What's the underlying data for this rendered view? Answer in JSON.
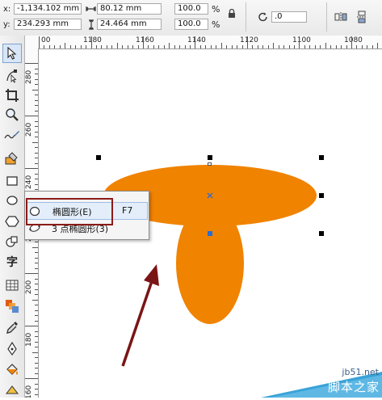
{
  "property_bar": {
    "x_label": "x:",
    "x_value": "-1,134.102 mm",
    "y_label": "y:",
    "y_value": "234.293 mm",
    "width_value": "80.12 mm",
    "height_value": "24.464 mm",
    "scale_x": "100.0",
    "scale_y": "100.0",
    "percent_1": "%",
    "percent_2": "%",
    "rotation_value": ".0"
  },
  "horizontal_ruler": {
    "labels": [
      "00",
      "1180",
      "1160",
      "1140",
      "1120",
      "1100",
      "1080"
    ]
  },
  "vertical_ruler": {
    "labels": [
      "280",
      "260",
      "240",
      "220",
      "200",
      "180",
      "160"
    ]
  },
  "toolbox": {
    "text_tool_glyph": "字"
  },
  "flyout": {
    "item1_label": "椭圆形(E)",
    "item1_shortcut": "F7",
    "item2_label": "3 点椭圆形(3)"
  },
  "watermark": {
    "site": "jb51.net",
    "brand": "脚本之家"
  },
  "colors": {
    "shape_fill": "#f08300",
    "arrow": "#7a1515",
    "highlight_box": "#8b1a1a",
    "center_marker": "#2a6bd6"
  }
}
